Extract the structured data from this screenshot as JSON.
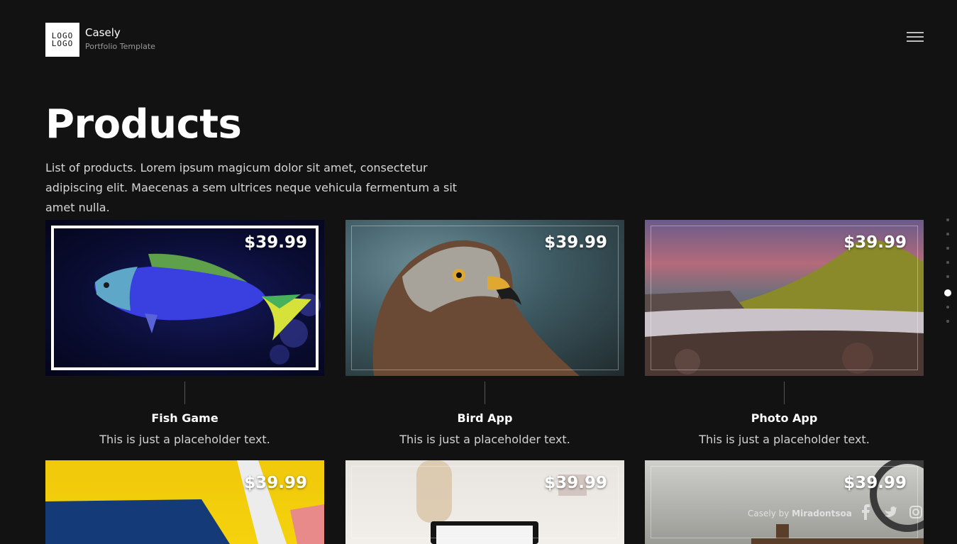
{
  "brand": {
    "logo_line1": "LOGO",
    "logo_line2": "LOGO",
    "name": "Casely",
    "tagline": "Portfolio Template"
  },
  "hero": {
    "title": "Products",
    "intro": "List of products. Lorem ipsum magicum dolor sit amet, consectetur adipiscing elit. Maecenas a sem ultrices neque vehicula fermentum a sit amet nulla."
  },
  "side_nav": {
    "count": 8,
    "active_index": 5
  },
  "products": [
    {
      "title": "Fish Game",
      "description": "This is just a placeholder text.",
      "price": "$39.99",
      "image": "fish-photo"
    },
    {
      "title": "Bird App",
      "description": "This is just a placeholder text.",
      "price": "$39.99",
      "image": "hawk-photo"
    },
    {
      "title": "Photo App",
      "description": "This is just a placeholder text.",
      "price": "$39.99",
      "image": "mountain-river-photo"
    },
    {
      "price": "$39.99",
      "image": "yellow-abstract-photo"
    },
    {
      "price": "$39.99",
      "image": "desk-laptop-photo"
    },
    {
      "price": "$39.99",
      "image": "interior-room-photo"
    }
  ],
  "footer": {
    "credit_prefix": "Casely by ",
    "credit_author": "Miradontsoa",
    "social_icons": [
      "facebook-icon",
      "twitter-icon",
      "instagram-icon"
    ]
  },
  "colors": {
    "background": "#121212",
    "text": "#ffffff",
    "muted": "#9a9a9a"
  }
}
